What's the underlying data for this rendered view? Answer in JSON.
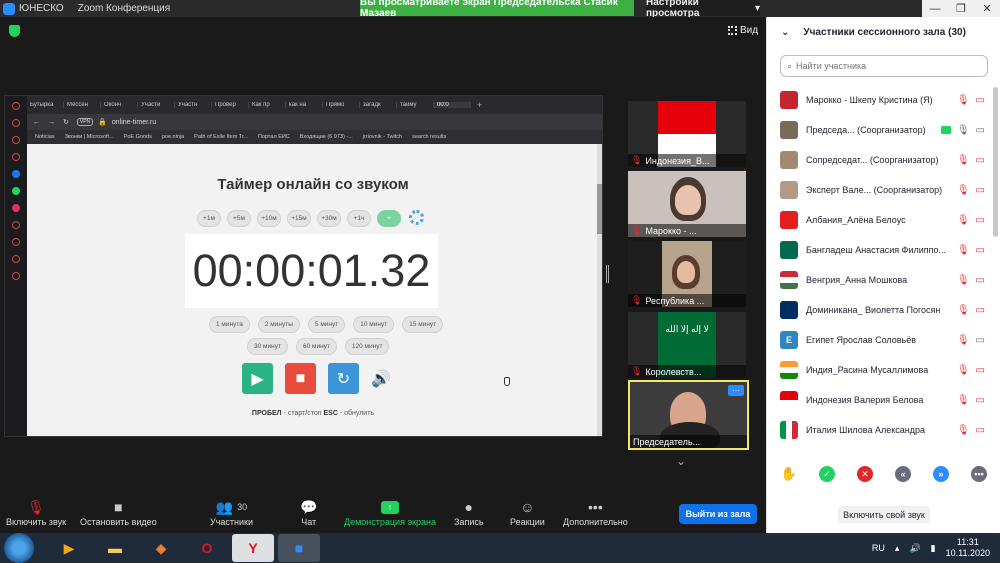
{
  "titlebar": {
    "app_name": "ЮНЕСКО",
    "window_title": "Zoom Конференция",
    "share_banner": "Вы просматриваете экран Председательска Стасик Мазаев",
    "view_settings": "Настройки просмотра",
    "view_settings_arrow": "▾",
    "window_controls": [
      "—",
      "❐",
      "✕"
    ]
  },
  "main": {
    "view_label": "Вид"
  },
  "browser": {
    "tabs": [
      "Бутырка",
      "Мессен",
      "Оконч",
      "Участи",
      "Участн",
      "Провер",
      "Как пр",
      "как на",
      "Прямо",
      "загадк",
      "тайму",
      "00:0"
    ],
    "new_tab": "+",
    "url": "online-timer.ru",
    "vpn": "VPN",
    "bookmarks": [
      "Noticias",
      "Звонки | Microsoft...",
      "PoE Goods",
      "poe.ninja",
      "Path of Exile Item Tr...",
      "Портал ЕИС",
      "Входящие (6 973) -...",
      "jrriovnik - Twitch",
      "search results"
    ],
    "page": {
      "title": "Таймер онлайн со звуком",
      "add_buttons": [
        "+1м",
        "+5м",
        "+10м",
        "+15м",
        "+30м",
        "+1ч",
        "+"
      ],
      "time": "00:00:01.32",
      "presets_row1": [
        "1 минута",
        "2 минуты",
        "5 минут",
        "10 минут",
        "15 минут"
      ],
      "presets_row2": [
        "30 минут",
        "60 минут",
        "120 минут"
      ],
      "hint_key1": "ПРОБЕЛ",
      "hint_text1": " - старт/стоп ",
      "hint_key2": "ESC",
      "hint_text2": " - обнулить"
    }
  },
  "tiles": [
    {
      "name": "Индонезия_В..."
    },
    {
      "name": "Марокко - ..."
    },
    {
      "name": "Республика ..."
    },
    {
      "name": "Королевств..."
    },
    {
      "name": "Председатель..."
    }
  ],
  "flag_sa_text": "لا إله إلا الله",
  "tile_more": "···",
  "toolbar": {
    "unmute": "Включить звук",
    "start_video": "Остановить видео",
    "participants": "Участники",
    "participants_count": "30",
    "chat": "Чат",
    "share": "Демонстрация экрана",
    "record": "Запись",
    "reactions": "Реакции",
    "more": "Дополнительно",
    "leave": "Выйти из зала"
  },
  "panel": {
    "title": "Участники сессионного зала (30)",
    "search_placeholder": "Найти участника",
    "participants": [
      {
        "name": "Марокко - Шкепу Кристина (Я)",
        "color": "#c1272d"
      },
      {
        "name": "Председа... (Соорганизатор)",
        "color": "#7a6a5a"
      },
      {
        "name": "Сопредседат... (Соорганизатор)",
        "color": "#a08a70"
      },
      {
        "name": "Эксперт Вале... (Соорганизатор)",
        "color": "#b39a86"
      },
      {
        "name": "Албания_Алёна Белоус",
        "color": "#e41e20"
      },
      {
        "name": "Бангладеш Анастасия Филиппо...",
        "color": "#006a4e"
      },
      {
        "name": "Венгрия_Анна Мошкова",
        "color": "#ce2939"
      },
      {
        "name": "Доминикана_ Виолетта Погосян",
        "color": "#002d62"
      },
      {
        "name": "Египет Ярослав Соловьёв",
        "color": "#2e86c1"
      },
      {
        "name": "Индия_Расина Мусаллимова",
        "color": "#ff9933"
      },
      {
        "name": "Индонезия Валерия Белова",
        "color": "#e7000b"
      },
      {
        "name": "Италия Шилова Александра",
        "color": "#009246"
      }
    ],
    "egypt_initial": "E",
    "unmute_my_audio": "Включить свой звук"
  },
  "taskbar": {
    "lang": "RU",
    "time": "11:31",
    "date": "10.11.2020"
  }
}
